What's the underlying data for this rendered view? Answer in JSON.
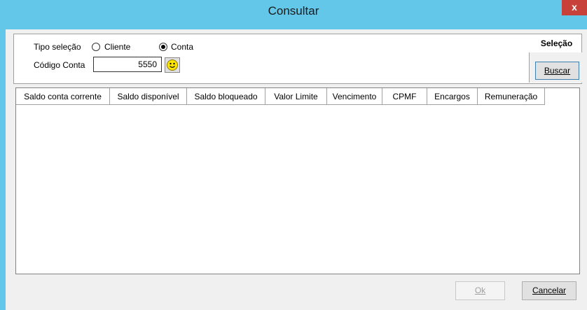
{
  "window": {
    "title": "Consultar",
    "close_label": "x"
  },
  "selection": {
    "tab_label": "Seleção",
    "tipo_label": "Tipo seleção",
    "options": [
      {
        "label": "Cliente",
        "checked": false
      },
      {
        "label": "Conta",
        "checked": true
      }
    ],
    "codigo_label": "Código Conta",
    "codigo_value": "5550",
    "search_button": "Buscar"
  },
  "grid": {
    "columns": [
      "Saldo conta corrente",
      "Saldo disponível",
      "Saldo bloqueado",
      "Valor Limite",
      "Vencimento",
      "CPMF",
      "Encargos",
      "Remuneração"
    ],
    "rows": []
  },
  "footer": {
    "ok_label": "Ok",
    "cancel_label": "Cancelar"
  },
  "colors": {
    "titlebar": "#63c7ea",
    "close": "#c7403a"
  }
}
